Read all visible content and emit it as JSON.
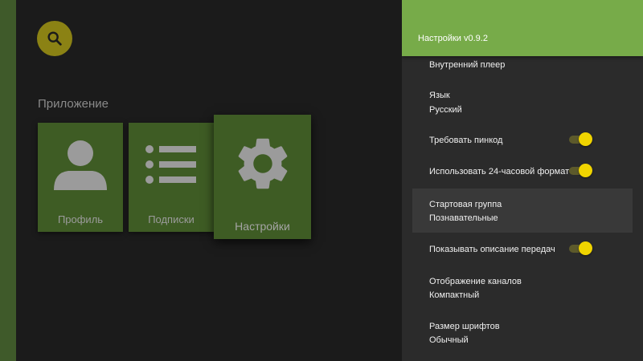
{
  "sidebar": {
    "search_icon": "search-icon",
    "accent": "#3f5a2a"
  },
  "main": {
    "section_title": "Приложение",
    "tiles": [
      {
        "label": "Профиль",
        "icon": "user-icon"
      },
      {
        "label": "Подписки",
        "icon": "list-icon"
      },
      {
        "label": "Настройки",
        "icon": "gear-icon",
        "focused": true
      }
    ]
  },
  "panel": {
    "title": "Настройки v0.9.2",
    "header_color": "#77ab49",
    "items": [
      {
        "label": "Внутренний плеер"
      },
      {
        "label": "Язык",
        "value": "Русский"
      },
      {
        "label": "Требовать пинкод",
        "toggle": true
      },
      {
        "label": "Использовать 24-часовой формат",
        "toggle": true
      },
      {
        "label": "Стартовая группа",
        "value": "Познавательные",
        "selected": true
      },
      {
        "label": "Показывать описание передач",
        "toggle": true
      },
      {
        "label": "Отображение каналов",
        "value": "Компактный"
      },
      {
        "label": "Размер шрифтов",
        "value": "Обычный"
      }
    ]
  }
}
